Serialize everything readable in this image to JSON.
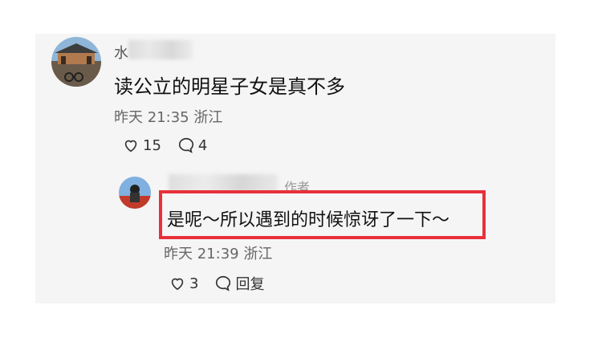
{
  "comment": {
    "username_visible": "水",
    "text": "读公立的明星子女是真不多",
    "time": "昨天 21:35",
    "location": "浙江",
    "likes": "15",
    "replies": "4"
  },
  "reply": {
    "author_tag": "作者",
    "text": "是呢～所以遇到的时候惊讶了一下～",
    "time": "昨天 21:39",
    "location": "浙江",
    "likes": "3",
    "reply_label": "回复"
  },
  "colors": {
    "highlight": "#e8303a",
    "background": "#f5f5f5"
  },
  "icons": [
    "heart-outline-icon",
    "comment-bubble-icon"
  ]
}
